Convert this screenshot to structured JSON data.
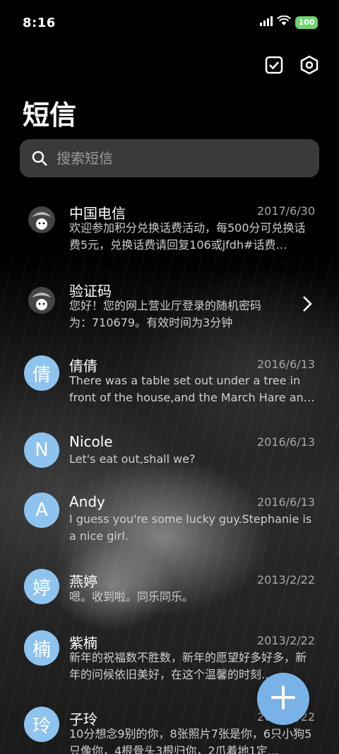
{
  "status_bar": {
    "time": "8:16",
    "battery": "100"
  },
  "header": {
    "title": "短信",
    "icons": [
      "checkbox-icon",
      "settings-hex-icon"
    ]
  },
  "search": {
    "placeholder": "搜索短信"
  },
  "messages": [
    {
      "name": "中国电信",
      "date": "2017/6/30",
      "avatar": "",
      "preview": "欢迎参加积分兑换话费活动，每500分可兑换话费5元，兑换话费请回复106或jfdh#话费…"
    },
    {
      "name": "验证码",
      "date": "",
      "avatar": "",
      "preview": "您好！您的网上营业厅登录的随机密码为：710679。有效时间为3分钟"
    },
    {
      "name": "倩倩",
      "date": "2016/6/13",
      "avatar": "倩",
      "preview": "There was a table set out under a tree in front of the house,and the March Hare an…"
    },
    {
      "name": "Nicole",
      "date": "2016/6/13",
      "avatar": "N",
      "preview": "Let's eat out,shall we?"
    },
    {
      "name": "Andy",
      "date": "2016/6/13",
      "avatar": "A",
      "preview": "I guess you're some lucky guy.Stephanie is a nice girl."
    },
    {
      "name": "燕婷",
      "date": "2013/2/22",
      "avatar": "婷",
      "preview": "嗯。收到啦。同乐同乐。"
    },
    {
      "name": "紫楠",
      "date": "2013/2/22",
      "avatar": "楠",
      "preview": "新年的祝福数不胜数，新年的愿望好多好多，新年的问候依旧美好，在这个温馨的时刻…"
    },
    {
      "name": "子玲",
      "date": "2013/2/22",
      "avatar": "玲",
      "preview": "10分想念9别的你，8张照片7张是你，6只小狗5只像你，4根骨头3根归你，2爪着地1定…"
    }
  ],
  "fab": {
    "icon": "plus-icon"
  }
}
